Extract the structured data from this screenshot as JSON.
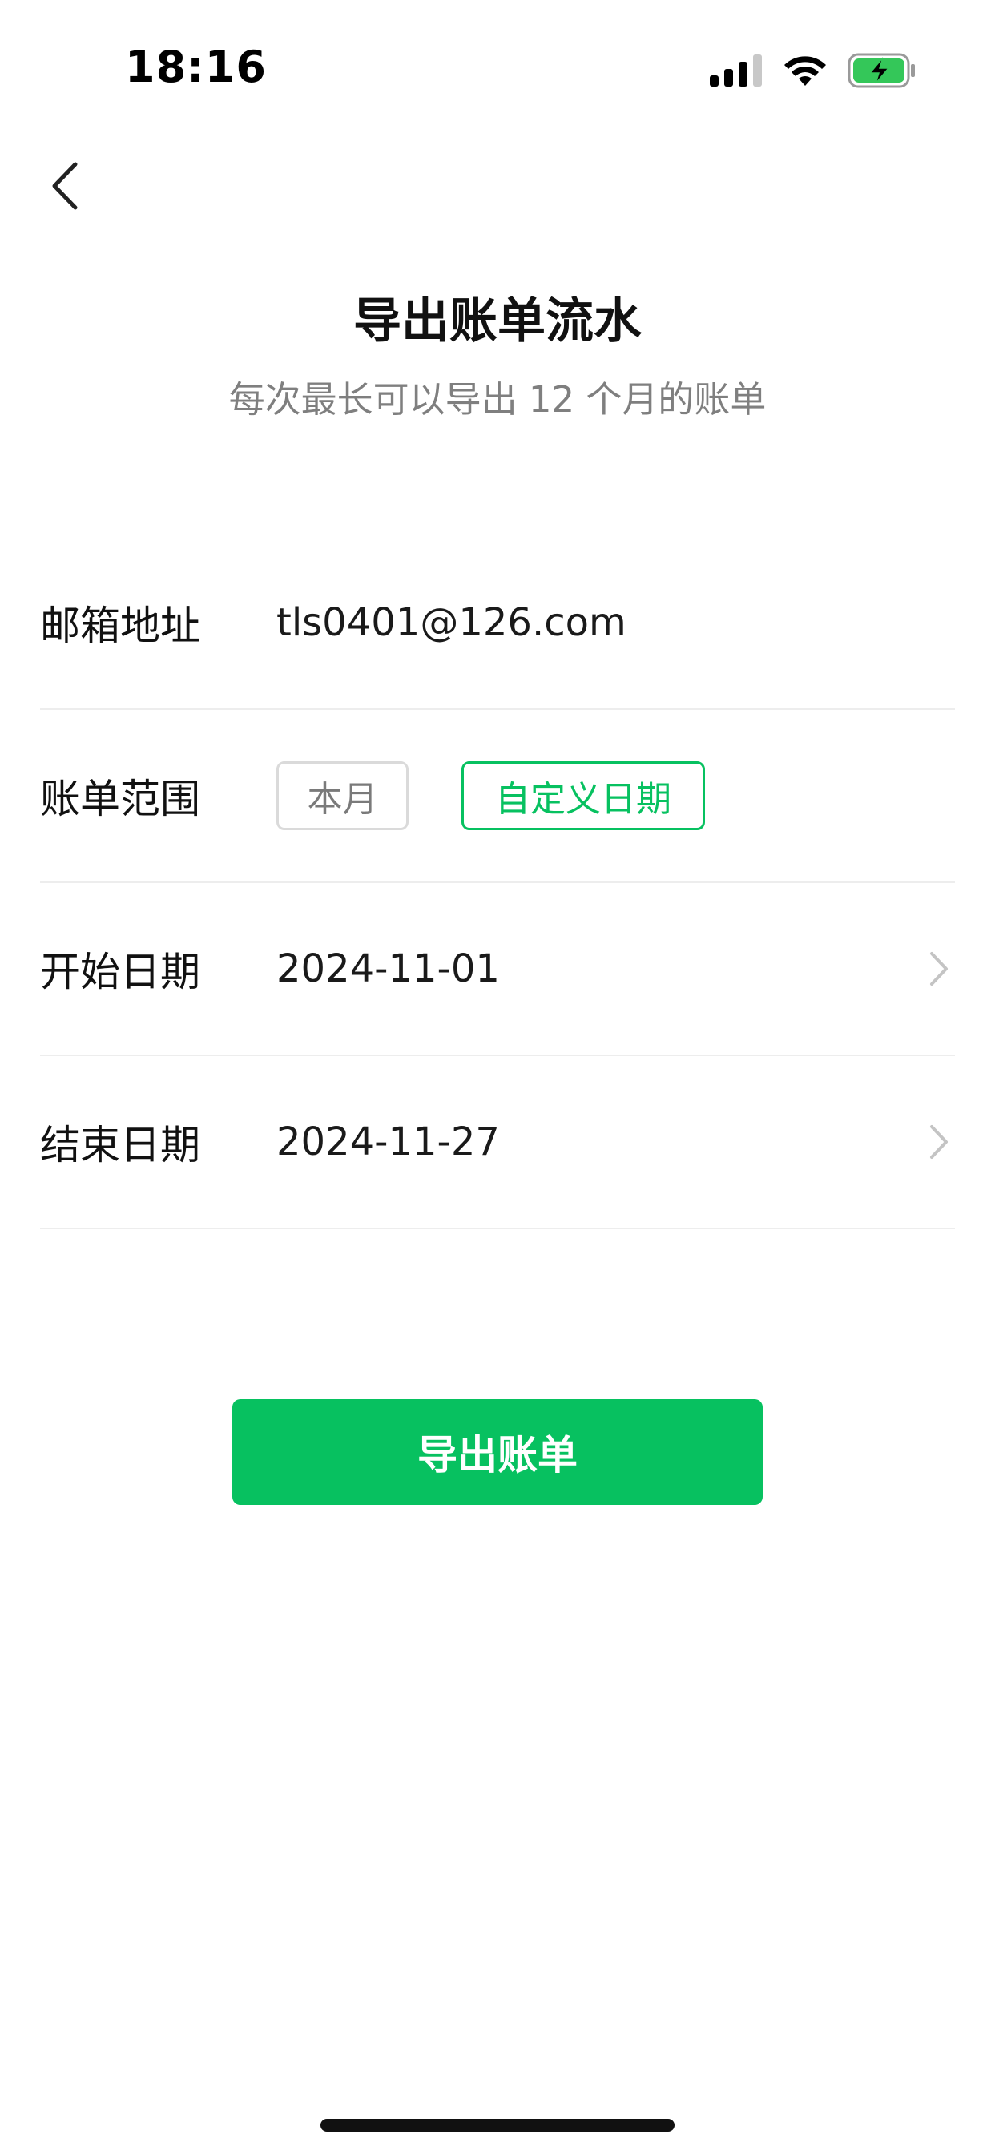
{
  "status_bar": {
    "time": "18:16",
    "icons": [
      "cellular-signal-icon",
      "wifi-icon",
      "battery-charging-icon"
    ],
    "battery_color": "#34c759"
  },
  "header": {
    "back_icon": "chevron-left-icon",
    "title": "导出账单流水",
    "subtitle": "每次最长可以导出 12 个月的账单"
  },
  "form": {
    "email": {
      "label": "邮箱地址",
      "value": "tls0401@126.com"
    },
    "range": {
      "label": "账单范围",
      "options": [
        {
          "label": "本月",
          "selected": false
        },
        {
          "label": "自定义日期",
          "selected": true
        }
      ]
    },
    "start_date": {
      "label": "开始日期",
      "value": "2024-11-01"
    },
    "end_date": {
      "label": "结束日期",
      "value": "2024-11-27"
    }
  },
  "actions": {
    "export_label": "导出账单"
  },
  "colors": {
    "accent": "#07c160",
    "text": "#111111",
    "muted": "#7f7f7f",
    "divider": "#ededed"
  }
}
